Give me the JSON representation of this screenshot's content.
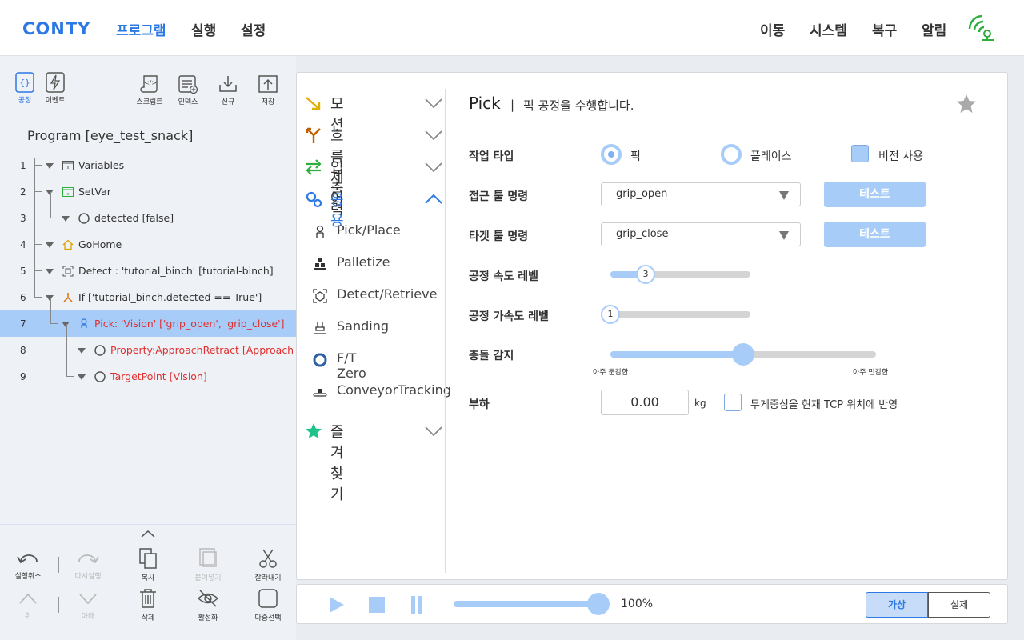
{
  "topbar": {
    "logo": "CONTY",
    "nav_left": [
      "프로그램",
      "실행",
      "설정"
    ],
    "nav_right": [
      "이동",
      "시스템",
      "복구",
      "알림"
    ],
    "active_nav": "프로그램",
    "accent": "#2c78e4"
  },
  "left_toolbar": {
    "items": [
      {
        "label": "공정",
        "icon": "braces-icon"
      },
      {
        "label": "이벤트",
        "icon": "lightning-icon"
      },
      {
        "label": "스크립트",
        "icon": "scroll-icon"
      },
      {
        "label": "인덱스",
        "icon": "index-icon"
      },
      {
        "label": "신규",
        "icon": "download-icon"
      },
      {
        "label": "저장",
        "icon": "upload-icon"
      }
    ]
  },
  "program": {
    "title": "Program [eye_test_snack]",
    "rows": [
      {
        "num": "1",
        "label": "Variables",
        "red": false,
        "icon": "variables-icon"
      },
      {
        "num": "2",
        "label": "SetVar",
        "red": false,
        "icon": "setvar-icon"
      },
      {
        "num": "3",
        "label": "detected [false]",
        "red": false,
        "icon": "circle-icon"
      },
      {
        "num": "4",
        "label": "GoHome",
        "red": false,
        "icon": "home-icon"
      },
      {
        "num": "5",
        "label": "Detect : 'tutorial_binch' [tutorial-binch]",
        "red": false,
        "icon": "detect-icon"
      },
      {
        "num": "6",
        "label": "If ['tutorial_binch.detected == True']",
        "red": false,
        "icon": "branch-icon"
      },
      {
        "num": "7",
        "label": "Pick: 'Vision' ['grip_open', 'grip_close']",
        "red": true,
        "icon": "gripper-icon"
      },
      {
        "num": "8",
        "label": "Property:ApproachRetract [Approach : ur",
        "red": true,
        "icon": "circle-icon"
      },
      {
        "num": "9",
        "label": "TargetPoint [Vision]",
        "red": true,
        "icon": "circle-icon"
      }
    ]
  },
  "bottom_tools": {
    "row1": [
      "실행취소",
      "다시실행",
      "복사",
      "붙여넣기",
      "잘라내기"
    ],
    "row2": [
      "위",
      "아래",
      "삭제",
      "활성화",
      "다중선택"
    ]
  },
  "categories": {
    "motion": "모션",
    "flow": "흐름제어",
    "io": "입출력",
    "app": "응용",
    "favorites": "즐겨찾기",
    "app_items": [
      "Pick/Place",
      "Palletize",
      "Detect/Retrieve",
      "Sanding",
      "F/T Zero",
      "ConveyorTracking"
    ]
  },
  "pick": {
    "title": "Pick",
    "separator": "|",
    "description": "픽 공정을 수행합니다.",
    "work_type_label": "작업 타입",
    "option_pick": "픽",
    "option_place": "플레이스",
    "vision_label": "비전 사용",
    "approach_label": "접근 툴 명령",
    "approach_value": "grip_open",
    "target_label": "타겟 툴 명령",
    "target_value": "grip_close",
    "test_label": "테스트",
    "speed_label": "공정 속도 레벨",
    "speed_value": "3",
    "accel_label": "공정 가속도 레벨",
    "accel_value": "1",
    "collision_label": "충돌 감지",
    "collision_level": 0.5,
    "collision_min": "아주 둔감한",
    "collision_max": "아주 민감한",
    "payload_label": "부하",
    "payload_value": "0.00",
    "payload_unit": "kg",
    "tcp_label": "무게중심을 현재 TCP 위치에 반영"
  },
  "player": {
    "speed_percent": "100%",
    "mode_virtual": "가상",
    "mode_real": "실제"
  }
}
